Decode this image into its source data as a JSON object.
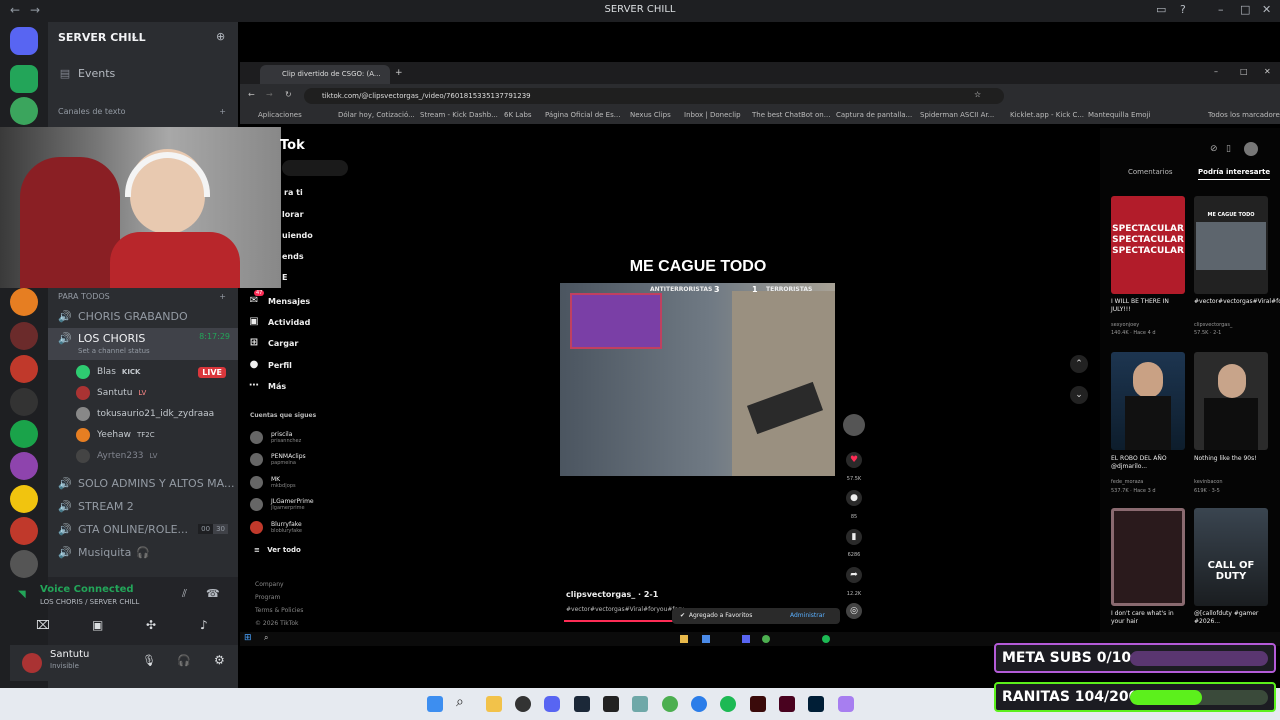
{
  "app": {
    "title": "SERVER CHILL"
  },
  "discord": {
    "server_name": "SERVER CHILL",
    "events_label": "Events",
    "text_category": "Canales de texto",
    "voice_category": "PARA TODOS",
    "channels": [
      {
        "name": "CHORIS GRABANDO"
      },
      {
        "name": "LOS CHORIS",
        "status": "Set a channel status",
        "timer": "8:17:29"
      },
      {
        "name": "SOLO ADMINS Y ALTOS MA..."
      },
      {
        "name": "STREAM 2"
      },
      {
        "name": "GTA ONLINE/ROLE...",
        "badge_left": "00",
        "badge_right": "30"
      },
      {
        "name": "Musiquita"
      }
    ],
    "voice_users": [
      {
        "name": "Blas",
        "tag": "KICK",
        "live": "LIVE"
      },
      {
        "name": "Santutu",
        "tag": "LV"
      },
      {
        "name": "tokusaurio21_idk_zydraaa",
        "tag": ""
      },
      {
        "name": "Yeehaw",
        "tag": "TF2C"
      },
      {
        "name": "Ayrten233",
        "tag": "LV"
      }
    ],
    "voice_connected": "Voice Connected",
    "voice_location": "LOS CHORIS / SERVER CHILL",
    "user_name": "Santutu",
    "user_status": "Invisible"
  },
  "browser": {
    "tab_title": "Clip divertido de CSGO: (A...",
    "url": "tiktok.com/@clipsvectorgas_/video/7601815335137791239",
    "bookmarks": [
      "Aplicaciones",
      "Dólar hoy, Cotizació...",
      "Stream - Kick Dashb...",
      "6K Labs",
      "Página Oficial de Es...",
      "Nexus Clips",
      "Inbox | Doneclip",
      "The best ChatBot on...",
      "Captura de pantalla...",
      "Spiderman ASCII Ar...",
      "Kicklet.app - Kick C...",
      "Mantequilla Emoji",
      "Todos los marcadores"
    ]
  },
  "tiktok": {
    "logo": "Tok",
    "nav_fragments": [
      "ra ti",
      "lorar",
      "uiendo",
      "ends",
      "E"
    ],
    "nav": [
      "Mensajes",
      "Actividad",
      "Cargar",
      "Perfil",
      "Más"
    ],
    "messages_badge": "47",
    "following_header": "Cuentas que sigues",
    "following": [
      {
        "name": "priscila",
        "handle": "prisannchez"
      },
      {
        "name": "PENMAclips",
        "handle": "papmeina"
      },
      {
        "name": "MK",
        "handle": "mkbd|ops"
      },
      {
        "name": "JLGamerPrime",
        "handle": "jlgamerprime"
      },
      {
        "name": "Blurryfake",
        "handle": "blobluryfake"
      }
    ],
    "see_all": "Ver todo",
    "footer": [
      "Company",
      "Program",
      "Terms & Policies",
      "© 2026 TikTok"
    ],
    "video_title": "ME CAGUE TODO",
    "score": {
      "left_team": "ANTITERRORISTAS",
      "left": "3",
      "right": "1",
      "right_team": "TERRORISTAS"
    },
    "author": "clipsvectorgas_ · 2-1",
    "hashtags": "#vector#vectorgas#Viral#foryou#fory...",
    "stats": {
      "likes": "57.5K",
      "comments": "85",
      "saves": "6286",
      "shares": "12.2K"
    },
    "toast": "Agregado a Favoritos",
    "toast_action": "Administrar",
    "tabs": [
      "Comentarios",
      "Podría interesarte"
    ],
    "recommendations": [
      {
        "caption": "I WILL BE THERE IN JULY!!!",
        "meta": "sexyonjoey",
        "views": "140.4K · Hace 4 d",
        "thumb_text": "SPECTACULAR SPECTACULAR SPECTACULAR"
      },
      {
        "caption": "#vector#vectorgas#Viral#foryou#f...",
        "meta": "clipsvectorgas_",
        "views": "57.5K · 2-1",
        "thumb_text": "ME CAGUE TODO"
      },
      {
        "caption": "EL ROBO DEL AÑO @djmarilo...",
        "meta": "fede_moraza",
        "views": "537.7K · Hace 3 d",
        "thumb_text": ""
      },
      {
        "caption": "Nothing like the 90s!",
        "meta": "kevinbacon",
        "views": "619K · 3-5",
        "thumb_text": ""
      },
      {
        "caption": "I don't care what's in your hair",
        "meta": "",
        "views": "",
        "thumb_text": ""
      },
      {
        "caption": "@[callofduty #gamer #2026...",
        "meta": "",
        "views": "",
        "thumb_text": "CALL OF DUTY"
      }
    ]
  },
  "overlays": [
    {
      "label": "META SUBS 0/10",
      "progress": 0.0,
      "color": "#b45bd8"
    },
    {
      "label": "RANITAS 104/200",
      "progress": 0.52,
      "color": "#5cf01c"
    }
  ]
}
